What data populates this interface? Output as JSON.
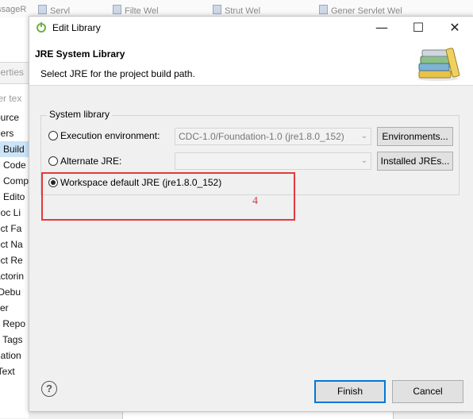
{
  "background": {
    "tabs": [
      "ssageR",
      "Servl",
      "Filte Wel",
      "Strut Wel",
      "Gener Servlet Wel"
    ],
    "sidebar_items": [
      "perties",
      "ter tex",
      "ource",
      "ders",
      "n Build",
      "n Code",
      "n Comp",
      "n Edito",
      "doc Li",
      "ect Fa",
      "ect Na",
      "ect Re",
      "actorin",
      "/Debu",
      "ver",
      "k Repo",
      "k Tags",
      "dation",
      "iText"
    ]
  },
  "dialog": {
    "title": "Edit Library",
    "window_controls": {
      "minimize": "—",
      "maximize": "☐",
      "close": "✕"
    },
    "heading": "JRE System Library",
    "description": "Select JRE for the project build path.",
    "group_label": "System library",
    "options": {
      "execution_env": {
        "label": "Execution environment:",
        "value": "CDC-1.0/Foundation-1.0 (jre1.8.0_152)",
        "button": "Environments...",
        "selected": false
      },
      "alternate_jre": {
        "label": "Alternate JRE:",
        "value": "",
        "button": "Installed JREs...",
        "selected": false
      },
      "workspace_default": {
        "label": "Workspace default JRE (jre1.8.0_152)",
        "selected": true
      }
    },
    "annotation": "4",
    "annotation_color": "#e23a3a",
    "buttons": {
      "finish": "Finish",
      "cancel": "Cancel"
    }
  }
}
